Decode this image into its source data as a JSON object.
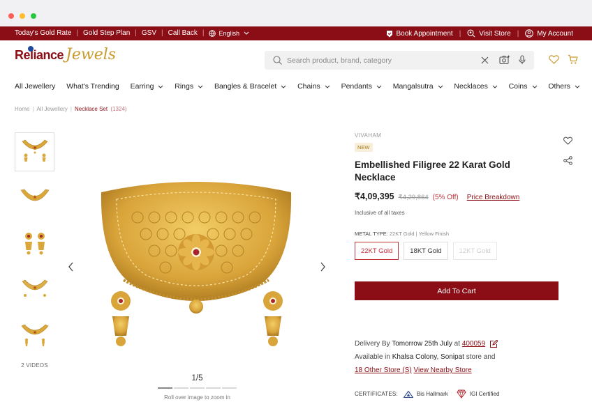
{
  "topbar": {
    "links": [
      "Today's Gold Rate",
      "Gold Step Plan",
      "GSV",
      "Call Back"
    ],
    "language": "English",
    "right_links": [
      "Book Appointment",
      "Visit Store",
      "My Account"
    ]
  },
  "header": {
    "logo_primary": "Reliance",
    "logo_secondary": "Jewels",
    "search_placeholder": "Search product, brand, category"
  },
  "nav": {
    "items": [
      {
        "label": "All Jewellery",
        "dropdown": false
      },
      {
        "label": "What's Trending",
        "dropdown": false
      },
      {
        "label": "Earring",
        "dropdown": true
      },
      {
        "label": "Rings",
        "dropdown": true
      },
      {
        "label": "Bangles & Bracelet",
        "dropdown": true
      },
      {
        "label": "Chains",
        "dropdown": true
      },
      {
        "label": "Pendants",
        "dropdown": true
      },
      {
        "label": "Mangalsutra",
        "dropdown": true
      },
      {
        "label": "Necklaces",
        "dropdown": true
      },
      {
        "label": "Coins",
        "dropdown": true
      },
      {
        "label": "Others",
        "dropdown": true
      }
    ]
  },
  "breadcrumb": {
    "items": [
      "Home",
      "All Jewellery"
    ],
    "current": "Necklace Set",
    "count": "(1324)"
  },
  "gallery": {
    "videos_label": "2 VIDEOS",
    "pager": "1/5",
    "zoom_hint": "Roll over image to zoom in"
  },
  "product": {
    "brand": "VIVAHAM",
    "badge": "NEW",
    "title": "Embellished Filigree 22 Karat Gold Necklace",
    "price": "₹4,09,395",
    "mrp": "₹4,29,864",
    "discount": "(5% Off)",
    "price_breakdown": "Price Breakdown",
    "tax_note": "Inclusive of all taxes",
    "metal_type_label": "METAL TYPE:",
    "metal_type_value": "22KT Gold | Yellow Finish",
    "metal_options": [
      "22KT Gold",
      "18KT Gold",
      "12KT Gold"
    ],
    "add_to_cart": "Add To Cart"
  },
  "delivery": {
    "prefix": "Delivery By",
    "date": "Tomorrow 25th July",
    "at": "at",
    "pincode": "400059",
    "available_prefix": "Available in",
    "location": "Khalsa Colony, Sonipat",
    "store_and": "store and",
    "other_stores": "18 Other Store (S)",
    "nearby": "View Nearby Store"
  },
  "certificates": {
    "label": "CERTIFICATES:",
    "items": [
      "Bis Hallmark",
      "IGI Certified"
    ]
  },
  "colors": {
    "brand_maroon": "#8b0e16",
    "gold": "#c99a2e"
  }
}
